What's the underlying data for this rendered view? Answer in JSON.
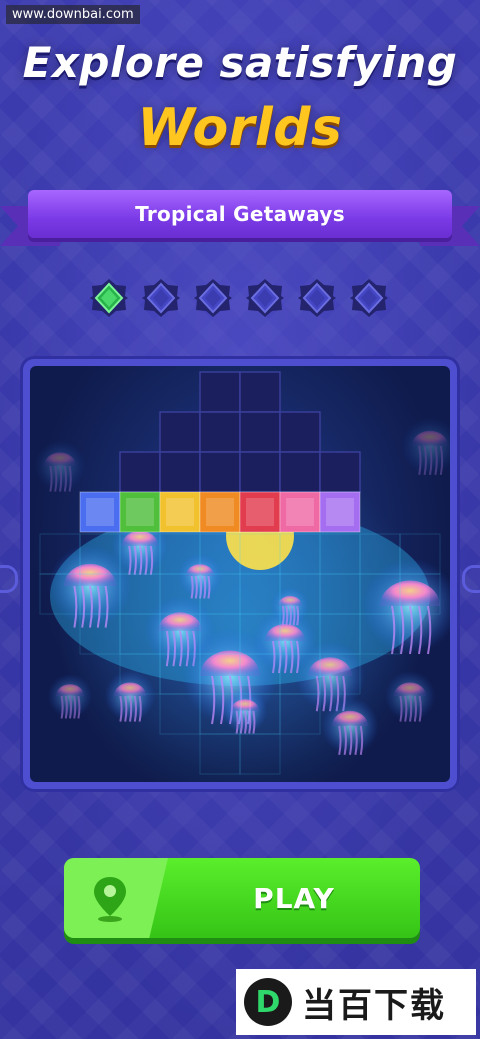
{
  "watermark_top": "www.downbai.com",
  "headline": {
    "line1": "Explore satisfying",
    "line2": "Worlds"
  },
  "banner": {
    "title": "Tropical Getaways"
  },
  "progress": {
    "total": 6,
    "completed": 1,
    "active_color": "#27b34a",
    "inactive_color": "#4446c4"
  },
  "board": {
    "block_colors": [
      "#4b6ef0",
      "#4fbf3c",
      "#f2c12e",
      "#f08a22",
      "#e23c4f",
      "#ef6aa5",
      "#a56ef0"
    ],
    "scene": "glowing-jellyfish-underwater"
  },
  "play_button": {
    "label": "PLAY",
    "icon": "map-pin-icon"
  },
  "brand_watermark": {
    "text": "当百下载",
    "logo": "D"
  }
}
